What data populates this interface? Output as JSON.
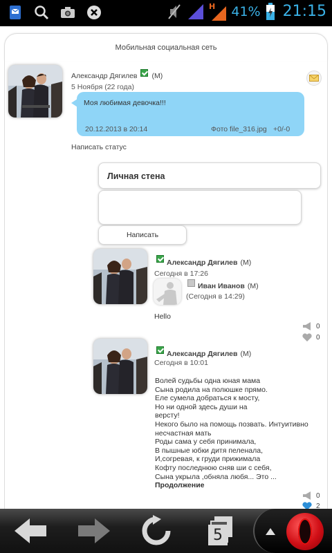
{
  "status_bar": {
    "battery": "41%",
    "time": "21:15",
    "icons": [
      "sms-icon",
      "search-icon",
      "camera-icon",
      "cancel-icon",
      "mute-icon",
      "signal-icon",
      "h-signal-icon",
      "battery-icon"
    ]
  },
  "header": {
    "title": "Мобильная социальная сеть"
  },
  "profile": {
    "name": "Александр Дягилев",
    "gender": "(M)",
    "birthday": "5 Ноября (22 года)",
    "status_text": "Моя любимая девочка!!!",
    "status_date": "20.12.2013 в 20:14",
    "status_photo": "Фото file_316.jpg",
    "status_votes": "+0/-0",
    "write_status": "Написать статус"
  },
  "wall": {
    "title": "Личная стена",
    "input_value": "",
    "submit": "Написать"
  },
  "posts": [
    {
      "author": "Александр Дягилев",
      "gender": "(M)",
      "time": "Сегодня в 17:26",
      "reply": {
        "author": "Иван Иванов",
        "gender": "(M)",
        "time": "(Сегодня в 14:29)"
      },
      "text": "Hello",
      "comments": "0",
      "likes": "0"
    },
    {
      "author": "Александр Дягилев",
      "gender": "(M)",
      "time": "Сегодня в 10:01",
      "text": "Волей судьбы одна юная мама\nСына родила на полюшке прямо.\nЕле сумела добраться к мосту,\nНо ни одной здесь души на\nверсту!\nНекого было на помощь позвать. Интуитивно\nнесчастная мать\nРоды сама у себя принимала,\nВ пышные юбки дитя пеленала,\nИ,согревая, к груди прижимала\nКофту последнюю сняв ши с себя,\nСына укрыла ,обняла любя... Это ...",
      "more": "Продолжение",
      "comments": "0",
      "likes": "2"
    }
  ],
  "nav": {
    "tabs_count": "5",
    "buttons": [
      "back-arrow-icon",
      "forward-arrow-icon",
      "reload-icon",
      "tabs-icon",
      "menu-up-icon",
      "opera-logo-icon"
    ]
  }
}
